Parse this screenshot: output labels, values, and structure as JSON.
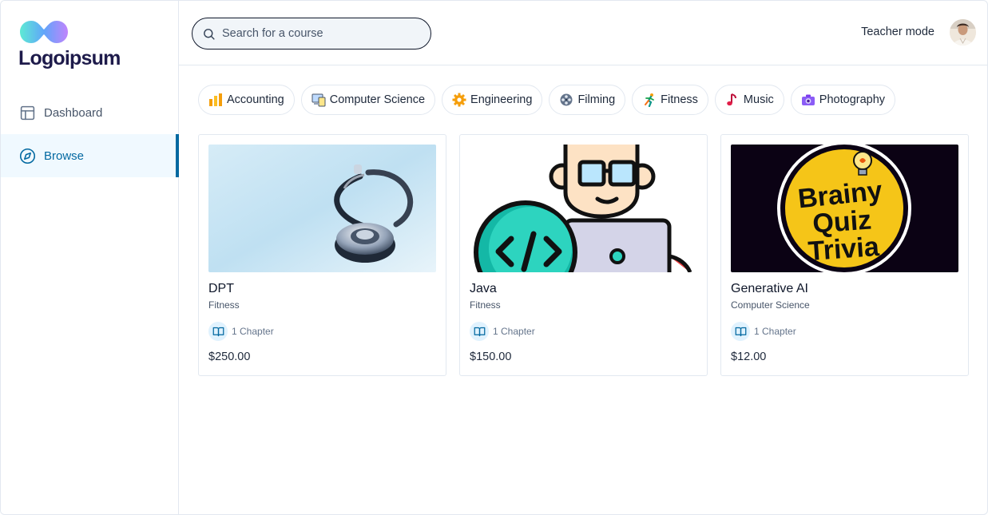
{
  "logo": {
    "text": "Logoipsum"
  },
  "sidebar": {
    "items": [
      {
        "label": "Dashboard",
        "icon": "layout-icon",
        "active": false
      },
      {
        "label": "Browse",
        "icon": "compass-icon",
        "active": true
      }
    ]
  },
  "header": {
    "search_placeholder": "Search for a course",
    "search_value": "",
    "teacher_mode_label": "Teacher mode"
  },
  "categories": [
    {
      "label": "Accounting",
      "icon": "bar-chart-icon"
    },
    {
      "label": "Computer Science",
      "icon": "computer-icon"
    },
    {
      "label": "Engineering",
      "icon": "gear-icon"
    },
    {
      "label": "Filming",
      "icon": "film-reel-icon"
    },
    {
      "label": "Fitness",
      "icon": "runner-icon"
    },
    {
      "label": "Music",
      "icon": "music-note-icon"
    },
    {
      "label": "Photography",
      "icon": "camera-icon"
    }
  ],
  "courses": [
    {
      "title": "DPT",
      "category": "Fitness",
      "chapters": "1 Chapter",
      "price": "$250.00",
      "image": "stethoscope-image"
    },
    {
      "title": "Java",
      "category": "Fitness",
      "chapters": "1 Chapter",
      "price": "$150.00",
      "image": "programmer-illustration"
    },
    {
      "title": "Generative AI",
      "category": "Computer Science",
      "chapters": "1 Chapter",
      "price": "$12.00",
      "image": "quiz-logo-image",
      "image_text": [
        "Brainy",
        "Quiz",
        "Trivia"
      ]
    }
  ],
  "colors": {
    "accent": "#0369a1",
    "active_bg": "#f0f9ff",
    "border": "#e2e8f0"
  }
}
